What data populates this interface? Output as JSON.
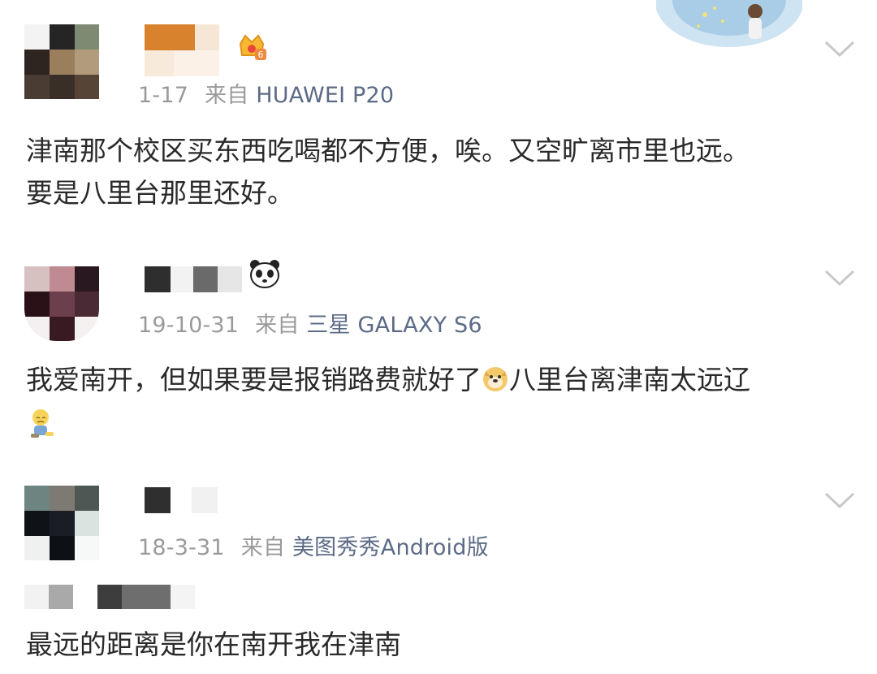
{
  "comments": [
    {
      "date": "1-17",
      "source_prefix": "来自",
      "device": "HUAWEI P20",
      "badge_icon": "crown-level-badge",
      "badge_level": "6",
      "text_line1": "津南那个校区买东西吃喝都不方便，唉。又空旷离市里也远。",
      "text_line2": "要是八里台那里还好。"
    },
    {
      "date": "19-10-31",
      "source_prefix": "来自",
      "device": "三星 GALAXY S6",
      "badge_icon": "panda-icon",
      "text_part1": "我爱南开，但如果要是报销路费就好了",
      "inline_emoji": "doge-emoji-icon",
      "text_part2": "八里台离津南太远辽",
      "trailing_emoji": "sitting-sad-emoji-icon"
    },
    {
      "date": "18-3-31",
      "source_prefix": "来自",
      "device": "美图秀秀Android版",
      "text_line1": "最远的距离是你在南开我在津南"
    }
  ],
  "colors": {
    "body_text": "#2a2a2a",
    "meta_text": "#9a9a9a",
    "device_text": "#5b6a86",
    "chevron": "#c8c8c8"
  }
}
